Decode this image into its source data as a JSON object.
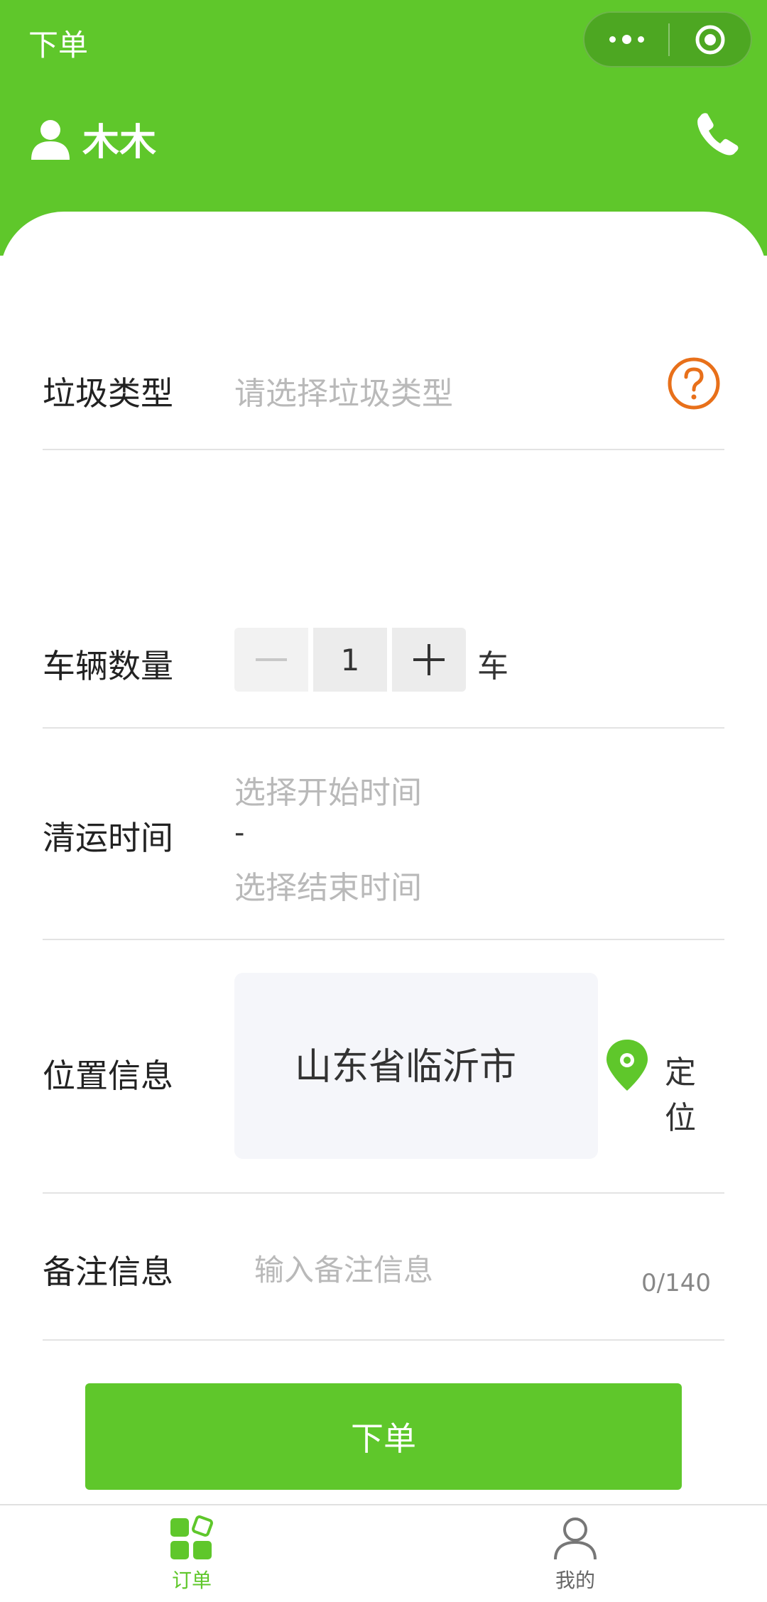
{
  "nav": {
    "title": "下单"
  },
  "user": {
    "name": "木木"
  },
  "form": {
    "type": {
      "label": "垃圾类型",
      "placeholder": "请选择垃圾类型"
    },
    "count": {
      "label": "车辆数量",
      "value": "1",
      "unit": "车"
    },
    "time": {
      "label": "清运时间",
      "start_placeholder": "选择开始时间",
      "separator": "-",
      "end_placeholder": "选择结束时间"
    },
    "location": {
      "label": "位置信息",
      "value": "山东省临沂市",
      "locate_label": "定位"
    },
    "note": {
      "label": "备注信息",
      "placeholder": "输入备注信息",
      "counter": "0/140"
    }
  },
  "submit_label": "下单",
  "tabbar": {
    "items": [
      {
        "label": "订单",
        "icon": "order-grid-icon",
        "active": true
      },
      {
        "label": "我的",
        "icon": "person-icon",
        "active": false
      }
    ]
  },
  "colors": {
    "brand": "#5fc72b",
    "help": "#e8701a",
    "divider": "#e3e3e3",
    "placeholder": "#b9b9b9"
  }
}
